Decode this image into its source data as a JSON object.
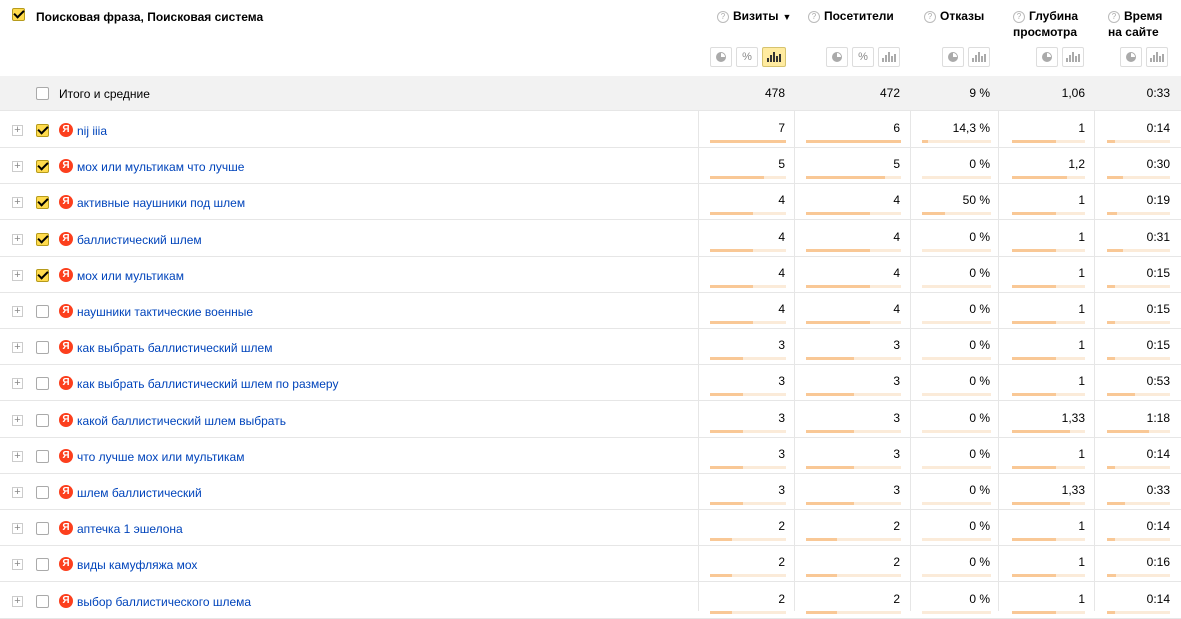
{
  "header": {
    "title": "Поисковая фраза, Поисковая система",
    "columns": [
      {
        "label": "Визиты",
        "sort": "▼"
      },
      {
        "label": "Посетители"
      },
      {
        "label": "Отказы"
      },
      {
        "label": "Глубина просмотра"
      },
      {
        "label": "Время на сайте"
      }
    ],
    "help_glyph": "?",
    "percent_glyph": "%",
    "active_view": "bars"
  },
  "totals": {
    "label": "Итого и средние",
    "visits": "478",
    "visitors": "472",
    "bounce": "9 %",
    "depth": "1,06",
    "time": "0:33"
  },
  "search_engine_glyph": "Я",
  "expand_glyph": "+",
  "rows": [
    {
      "phrase": "nij iiia",
      "checked": true,
      "visits": "7",
      "visitors": "6",
      "bounce": "14,3 %",
      "depth": "1",
      "time": "0:14",
      "visits_frac": 1.0,
      "visitors_frac": 1.0,
      "bounce_frac": 0.09,
      "depth_frac": 0.6,
      "time_frac": 0.12
    },
    {
      "phrase": "мох или мультикам что лучше",
      "checked": true,
      "visits": "5",
      "visitors": "5",
      "bounce": "0 %",
      "depth": "1,2",
      "time": "0:30",
      "visits_frac": 0.71,
      "visitors_frac": 0.83,
      "bounce_frac": 0,
      "depth_frac": 0.75,
      "time_frac": 0.25
    },
    {
      "phrase": "активные наушники под шлем",
      "checked": true,
      "visits": "4",
      "visitors": "4",
      "bounce": "50 %",
      "depth": "1",
      "time": "0:19",
      "visits_frac": 0.57,
      "visitors_frac": 0.67,
      "bounce_frac": 0.34,
      "depth_frac": 0.6,
      "time_frac": 0.16
    },
    {
      "phrase": "баллистический шлем",
      "checked": true,
      "visits": "4",
      "visitors": "4",
      "bounce": "0 %",
      "depth": "1",
      "time": "0:31",
      "visits_frac": 0.57,
      "visitors_frac": 0.67,
      "bounce_frac": 0,
      "depth_frac": 0.6,
      "time_frac": 0.26
    },
    {
      "phrase": "мох или мультикам",
      "checked": true,
      "visits": "4",
      "visitors": "4",
      "bounce": "0 %",
      "depth": "1",
      "time": "0:15",
      "visits_frac": 0.57,
      "visitors_frac": 0.67,
      "bounce_frac": 0,
      "depth_frac": 0.6,
      "time_frac": 0.13
    },
    {
      "phrase": "наушники тактические военные",
      "checked": false,
      "visits": "4",
      "visitors": "4",
      "bounce": "0 %",
      "depth": "1",
      "time": "0:15",
      "visits_frac": 0.57,
      "visitors_frac": 0.67,
      "bounce_frac": 0,
      "depth_frac": 0.6,
      "time_frac": 0.13
    },
    {
      "phrase": "как выбрать баллистический шлем",
      "checked": false,
      "visits": "3",
      "visitors": "3",
      "bounce": "0 %",
      "depth": "1",
      "time": "0:15",
      "visits_frac": 0.43,
      "visitors_frac": 0.5,
      "bounce_frac": 0,
      "depth_frac": 0.6,
      "time_frac": 0.13
    },
    {
      "phrase": "как выбрать баллистический шлем по размеру",
      "checked": false,
      "visits": "3",
      "visitors": "3",
      "bounce": "0 %",
      "depth": "1",
      "time": "0:53",
      "visits_frac": 0.43,
      "visitors_frac": 0.5,
      "bounce_frac": 0,
      "depth_frac": 0.6,
      "time_frac": 0.45
    },
    {
      "phrase": "какой баллистический шлем выбрать",
      "checked": false,
      "visits": "3",
      "visitors": "3",
      "bounce": "0 %",
      "depth": "1,33",
      "time": "1:18",
      "visits_frac": 0.43,
      "visitors_frac": 0.5,
      "bounce_frac": 0,
      "depth_frac": 0.8,
      "time_frac": 0.66
    },
    {
      "phrase": "что лучше мох или мультикам",
      "checked": false,
      "visits": "3",
      "visitors": "3",
      "bounce": "0 %",
      "depth": "1",
      "time": "0:14",
      "visits_frac": 0.43,
      "visitors_frac": 0.5,
      "bounce_frac": 0,
      "depth_frac": 0.6,
      "time_frac": 0.12
    },
    {
      "phrase": "шлем баллистический",
      "checked": false,
      "visits": "3",
      "visitors": "3",
      "bounce": "0 %",
      "depth": "1,33",
      "time": "0:33",
      "visits_frac": 0.43,
      "visitors_frac": 0.5,
      "bounce_frac": 0,
      "depth_frac": 0.8,
      "time_frac": 0.28
    },
    {
      "phrase": "аптечка 1 эшелона",
      "checked": false,
      "visits": "2",
      "visitors": "2",
      "bounce": "0 %",
      "depth": "1",
      "time": "0:14",
      "visits_frac": 0.29,
      "visitors_frac": 0.33,
      "bounce_frac": 0,
      "depth_frac": 0.6,
      "time_frac": 0.12
    },
    {
      "phrase": "виды камуфляжа мох",
      "checked": false,
      "visits": "2",
      "visitors": "2",
      "bounce": "0 %",
      "depth": "1",
      "time": "0:16",
      "visits_frac": 0.29,
      "visitors_frac": 0.33,
      "bounce_frac": 0,
      "depth_frac": 0.6,
      "time_frac": 0.14
    },
    {
      "phrase": "выбор баллистического шлема",
      "checked": false,
      "visits": "2",
      "visitors": "2",
      "bounce": "0 %",
      "depth": "1",
      "time": "0:14",
      "visits_frac": 0.29,
      "visitors_frac": 0.33,
      "bounce_frac": 0,
      "depth_frac": 0.6,
      "time_frac": 0.12
    }
  ]
}
